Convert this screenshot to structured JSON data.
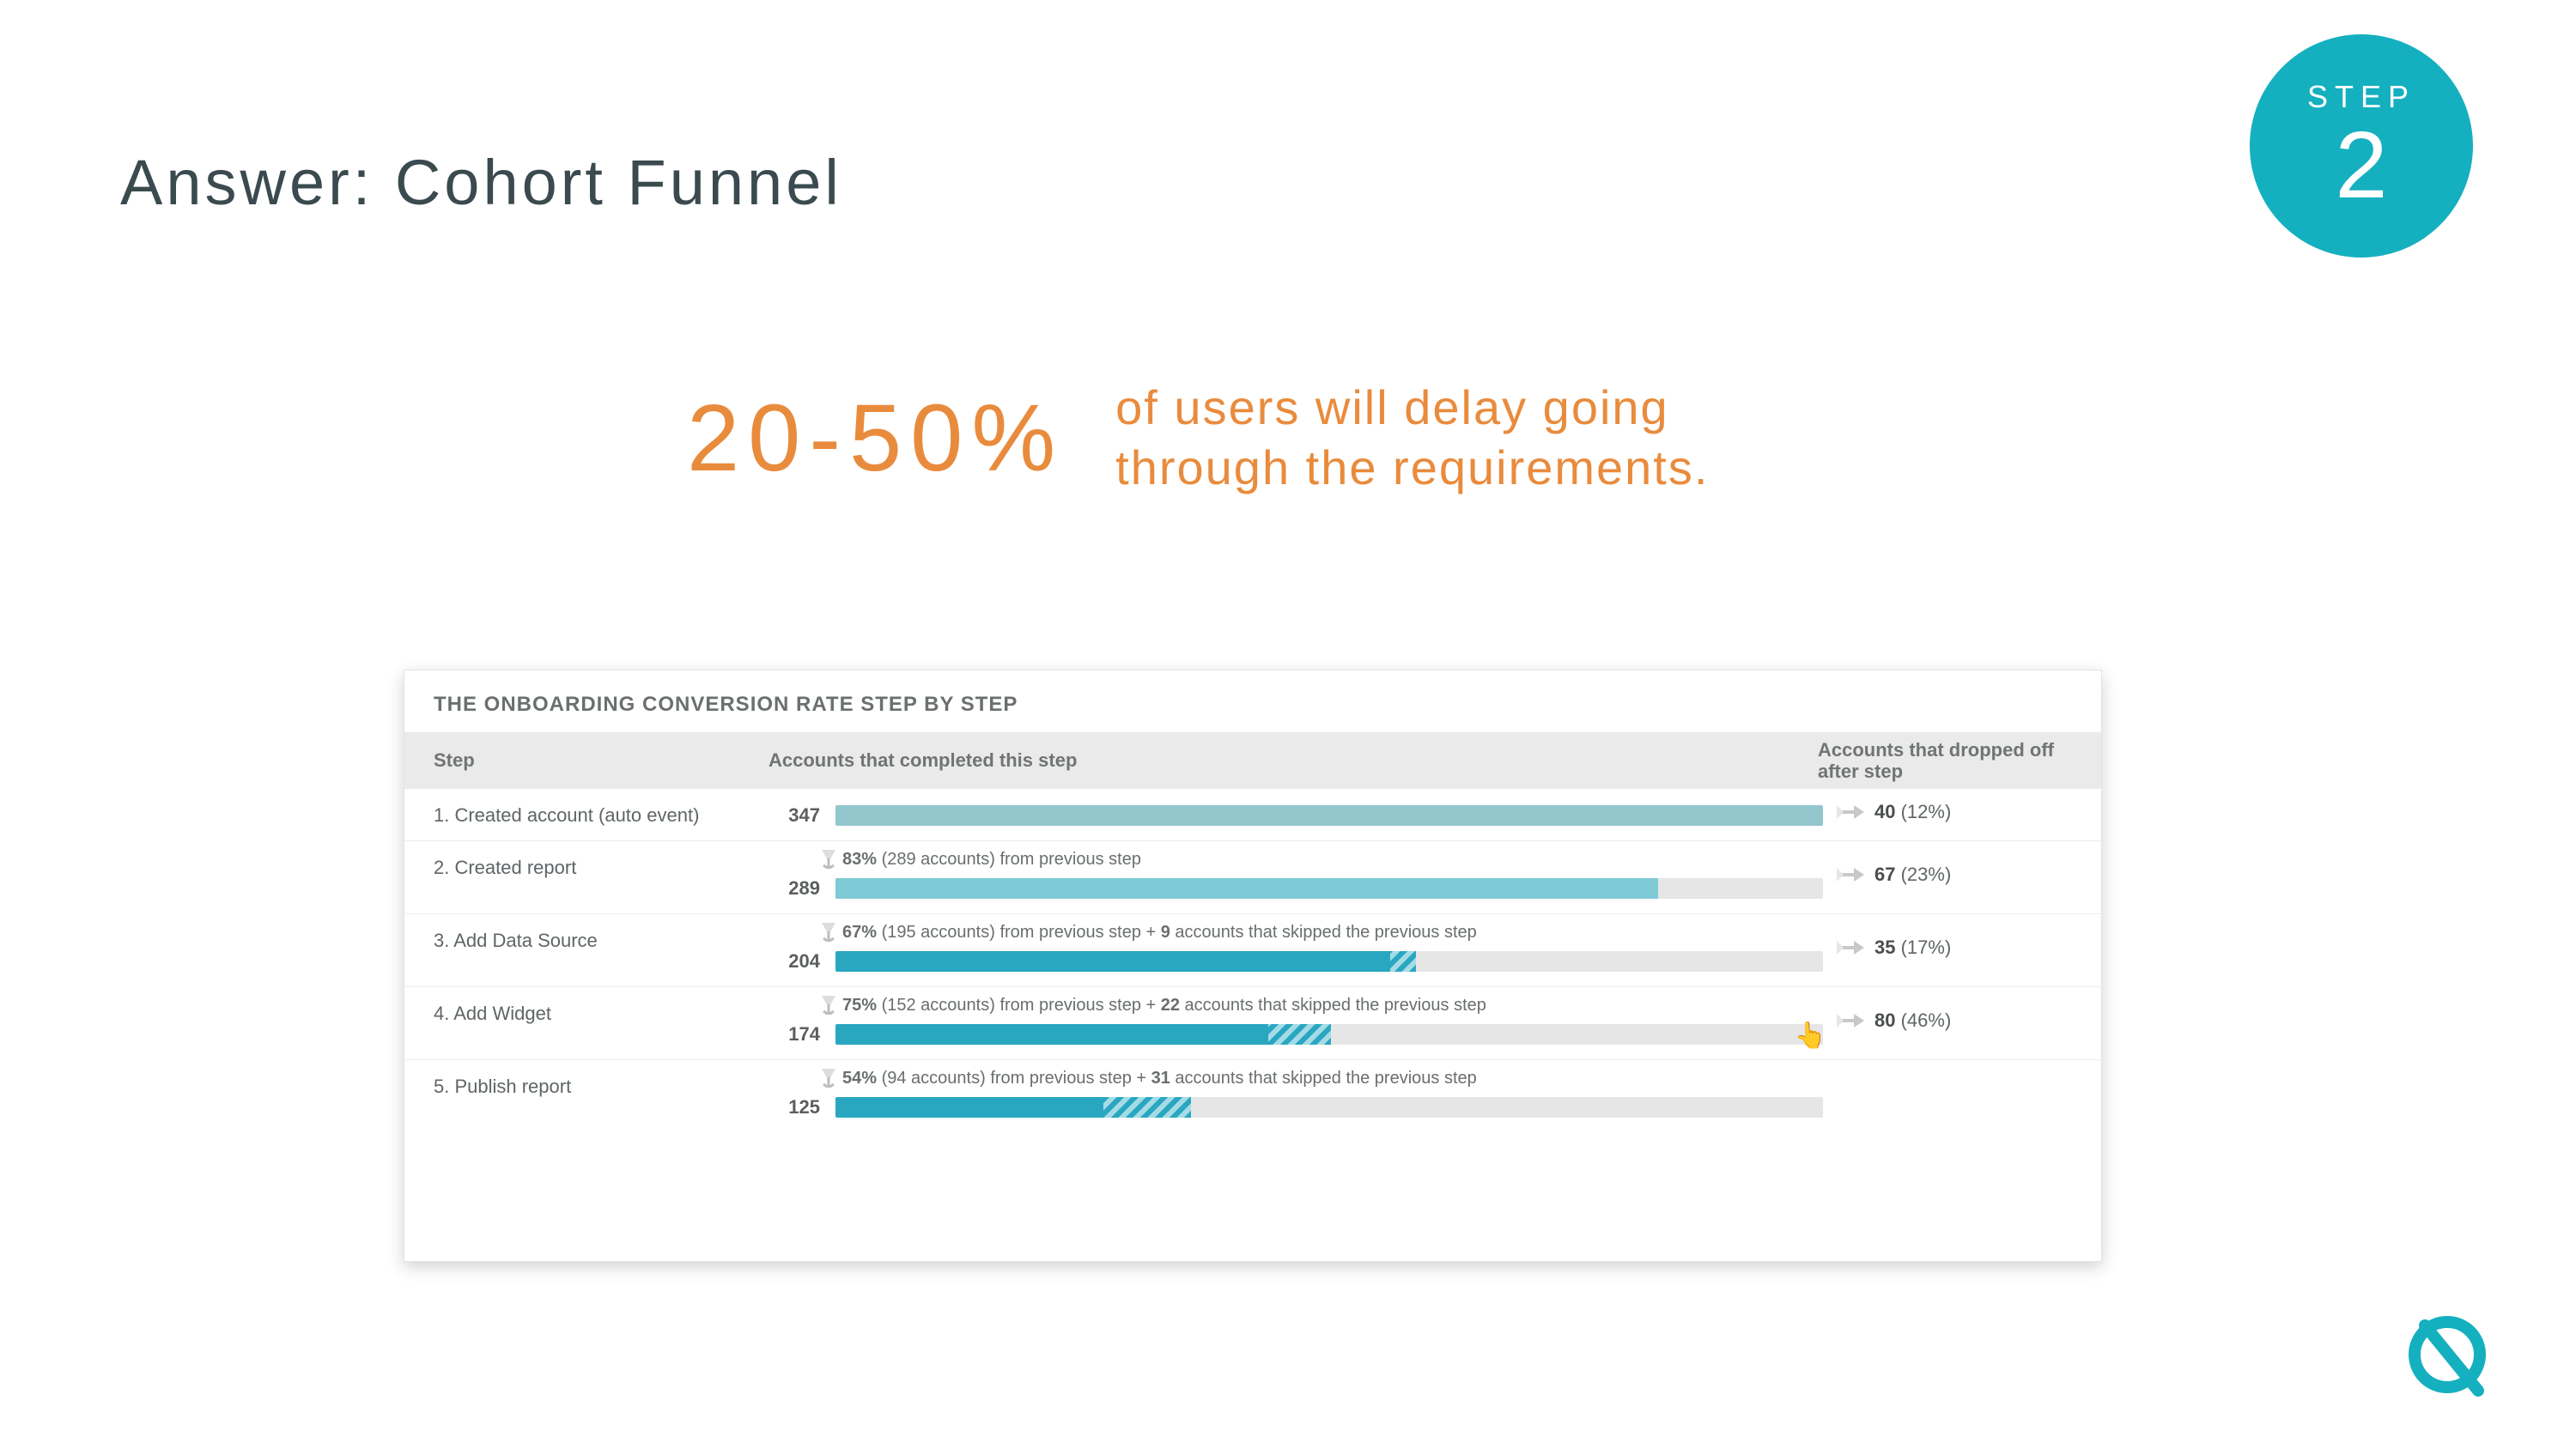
{
  "slide": {
    "title": "Answer: Cohort Funnel",
    "step_badge": {
      "label": "STEP",
      "number": "2"
    },
    "stat": {
      "pct": "20-50%",
      "text_line1": "of users will delay going",
      "text_line2": "through the requirements."
    }
  },
  "panel": {
    "title": "THE ONBOARDING CONVERSION RATE STEP BY STEP",
    "headers": {
      "step": "Step",
      "completed": "Accounts that completed this step",
      "dropped": "Accounts that dropped off after step"
    }
  },
  "chart_data": {
    "type": "bar",
    "title": "THE ONBOARDING CONVERSION RATE STEP BY STEP",
    "base_accounts": 347,
    "max_bar_value": 347,
    "columns": [
      "Step",
      "Accounts that completed this step",
      "Accounts that dropped off after step"
    ],
    "steps": [
      {
        "label": "1. Created account (auto event)",
        "completed": 347,
        "from_prev_pct": null,
        "from_prev_count": null,
        "skipped_count": 0,
        "note_text": "",
        "dropoff_count": 40,
        "dropoff_pct": 12,
        "bar_color": "#4fa9b8",
        "bar_opacity": 0.55
      },
      {
        "label": "2. Created report",
        "completed": 289,
        "from_prev_pct": 83,
        "from_prev_count": 289,
        "skipped_count": 0,
        "note_text": "83% (289 accounts) from previous step",
        "dropoff_count": 67,
        "dropoff_pct": 23,
        "bar_color": "#5cc0d2",
        "bar_opacity": 0.75
      },
      {
        "label": "3. Add Data Source",
        "completed": 204,
        "from_prev_pct": 67,
        "from_prev_count": 195,
        "skipped_count": 9,
        "note_text": "67% (195 accounts) from previous step + 9 accounts that skipped the previous step",
        "dropoff_count": 35,
        "dropoff_pct": 17,
        "bar_color": "#2aa7c0",
        "bar_opacity": 1.0
      },
      {
        "label": "4. Add Widget",
        "completed": 174,
        "from_prev_pct": 75,
        "from_prev_count": 152,
        "skipped_count": 22,
        "note_text": "75% (152 accounts) from previous step + 22 accounts that skipped the previous step",
        "dropoff_count": 80,
        "dropoff_pct": 46,
        "bar_color": "#2aa7c0",
        "bar_opacity": 1.0
      },
      {
        "label": "5. Publish report",
        "completed": 125,
        "from_prev_pct": 54,
        "from_prev_count": 94,
        "skipped_count": 31,
        "note_text": "54% (94 accounts) from previous step + 31 accounts that skipped the previous step",
        "dropoff_count": null,
        "dropoff_pct": null,
        "bar_color": "#2aa7c0",
        "bar_opacity": 1.0
      }
    ],
    "pointer_step_index": 3
  }
}
